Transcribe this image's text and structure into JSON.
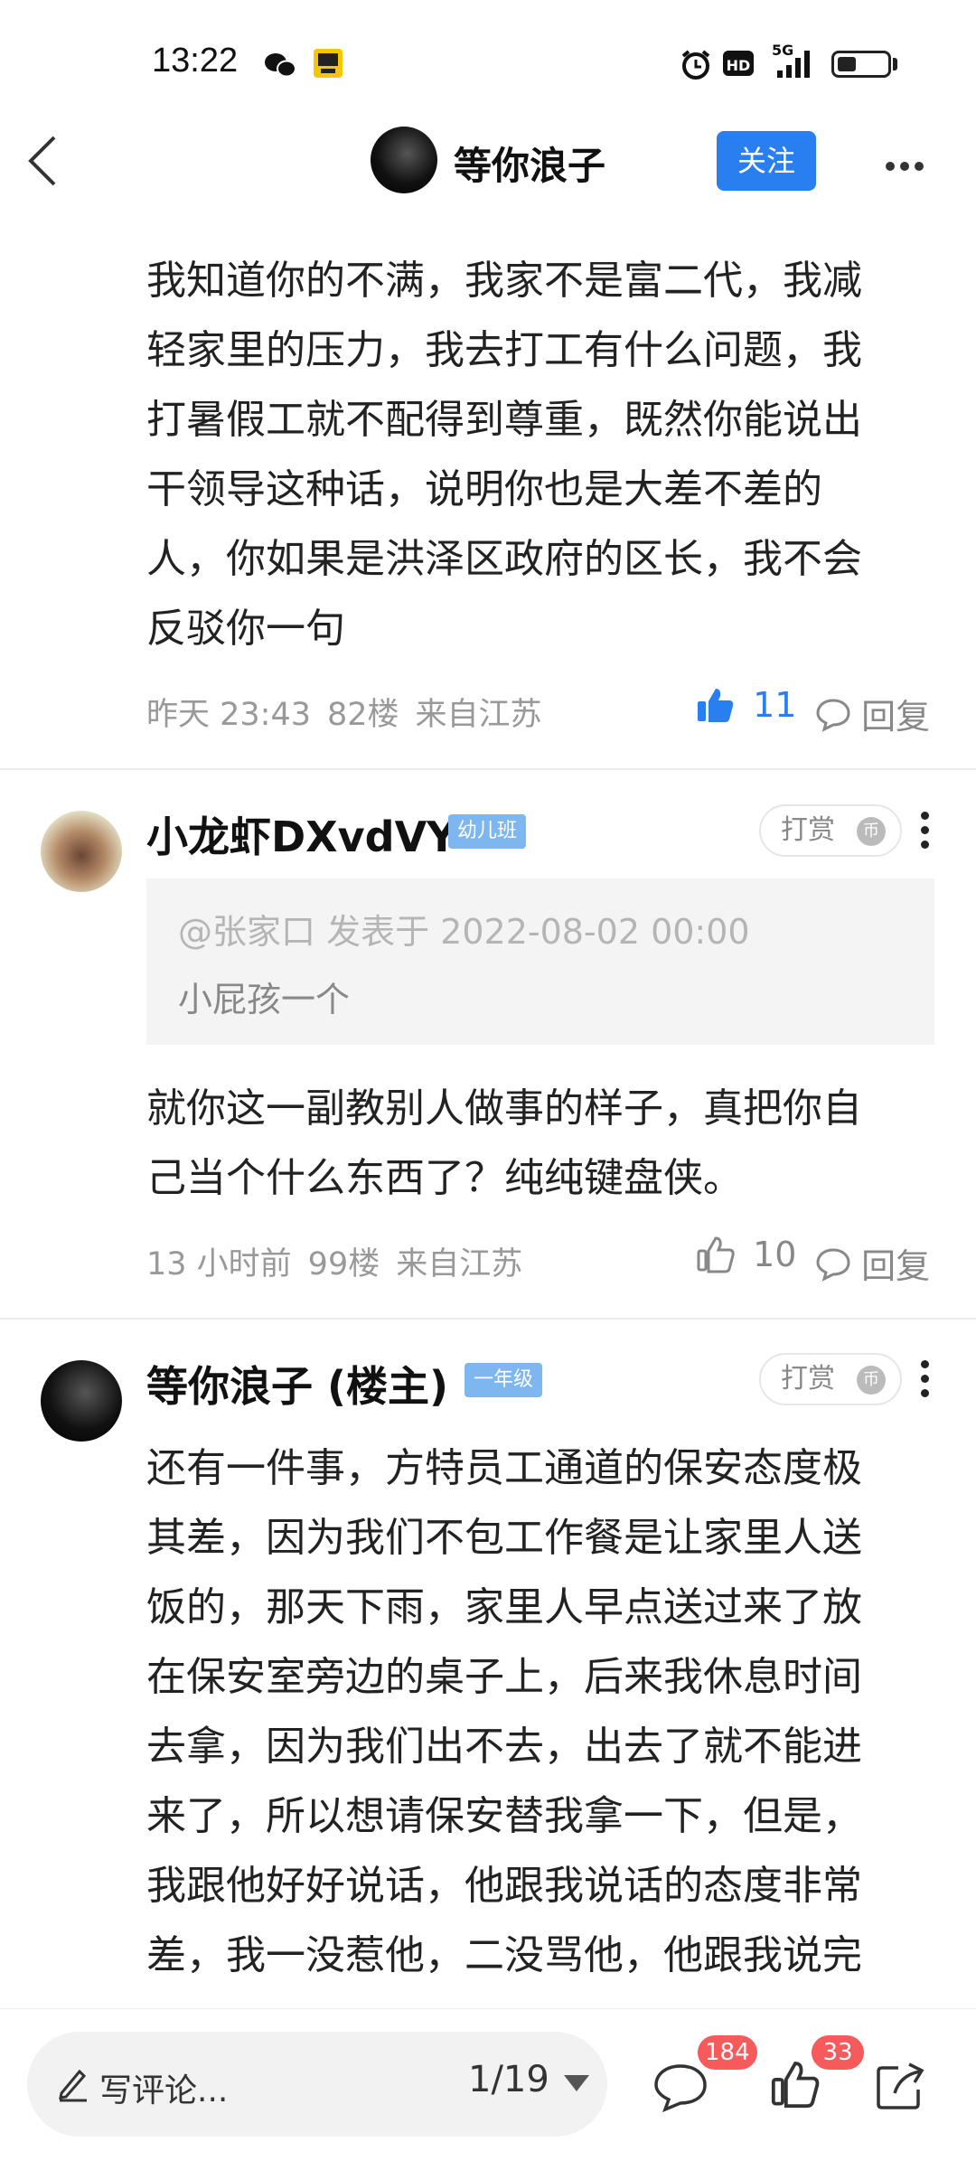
{
  "status_bar": {
    "time": "13:22",
    "network": "5G",
    "hd": "HD",
    "icons": [
      "wechat-icon",
      "app-notification-icon",
      "alarm-icon",
      "hd-icon",
      "signal-icon",
      "battery-icon"
    ]
  },
  "header": {
    "back_icon": "back-chevron-icon",
    "title": "等你浪子",
    "follow_label": "关注",
    "more_icon": "more-horizontal-icon"
  },
  "posts": [
    {
      "lines": [
        "我知道你的不满，我家不是富二代，我减",
        "轻家里的压力，我去打工有什么问题，我",
        "打暑假工就不配得到尊重，既然你能说出",
        "干领导这种话，说明你也是大差不差的",
        "人，你如果是洪泽区政府的区长，我不会",
        "反驳你一句"
      ],
      "time": "昨天 23:43",
      "floor": "82楼",
      "location": "来自江苏",
      "likes": "11",
      "reply_label": "回复"
    },
    {
      "username": "小龙虾DXvdVY",
      "level": "幼儿班",
      "tip_label": "打赏",
      "quote_header": "@张家口 发表于 2022-08-02 00:00",
      "quote_text": "小屁孩一个",
      "lines": [
        "就你这一副教别人做事的样子，真把你自",
        "己当个什么东西了？纯纯键盘侠。"
      ],
      "time": "13 小时前",
      "floor": "99楼",
      "location": "来自江苏",
      "likes": "10",
      "reply_label": "回复"
    },
    {
      "username": "等你浪子 (楼主)",
      "level": "一年级",
      "tip_label": "打赏",
      "lines": [
        "还有一件事，方特员工通道的保安态度极",
        "其差，因为我们不包工作餐是让家里人送",
        "饭的，那天下雨，家里人早点送过来了放",
        "在保安室旁边的桌子上，后来我休息时间",
        "去拿，因为我们出不去，出去了就不能进",
        "来了，所以想请保安替我拿一下，但是，",
        "我跟他好好说话，他跟我说话的态度非常",
        "差，我一没惹他，二没骂他，他跟我说完"
      ]
    }
  ],
  "bottom_bar": {
    "comment_placeholder": "写评论...",
    "page_indicator": "1/19",
    "comment_count": "184",
    "like_count": "33"
  },
  "colors": {
    "accent": "#2a7ff0",
    "badge": "#f65a5a",
    "level_badge": "#7eb6f0"
  }
}
